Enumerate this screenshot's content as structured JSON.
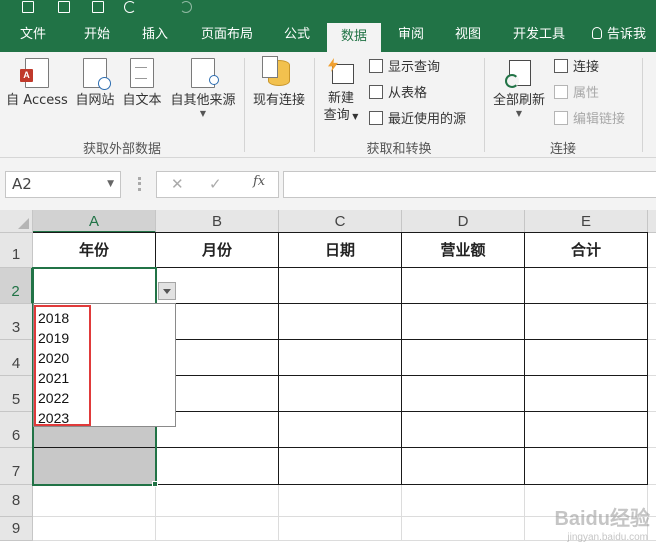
{
  "ribbon": {
    "tabs": [
      {
        "label": "文件"
      },
      {
        "label": "开始"
      },
      {
        "label": "插入"
      },
      {
        "label": "页面布局"
      },
      {
        "label": "公式"
      },
      {
        "label": "数据"
      },
      {
        "label": "审阅"
      },
      {
        "label": "视图"
      },
      {
        "label": "开发工具"
      },
      {
        "label": "告诉我"
      }
    ],
    "active_tab": "数据",
    "groups": {
      "external": {
        "label": "获取外部数据",
        "from_access": "自 Access",
        "from_web": "自网站",
        "from_text": "自文本",
        "from_other": "自其他来源",
        "existing_conn": "现有连接"
      },
      "transform": {
        "label": "获取和转换",
        "new_query_1": "新建",
        "new_query_2": "查询",
        "show_queries": "显示查询",
        "from_table": "从表格",
        "recent_sources": "最近使用的源"
      },
      "connections": {
        "label": "连接",
        "refresh_all": "全部刷新",
        "connections": "连接",
        "properties": "属性",
        "edit_links": "编辑链接"
      }
    }
  },
  "formula_bar": {
    "name_box": "A2",
    "formula": ""
  },
  "sheet": {
    "columns": [
      "A",
      "B",
      "C",
      "D",
      "E"
    ],
    "rows": [
      "1",
      "2",
      "3",
      "4",
      "5",
      "6",
      "7",
      "8",
      "9"
    ],
    "headers": [
      "年份",
      "月份",
      "日期",
      "营业额",
      "合计"
    ],
    "selected_column": "A"
  },
  "dropdown": {
    "options": [
      "2018",
      "2019",
      "2020",
      "2021",
      "2022",
      "2023"
    ]
  },
  "watermark": {
    "main": "Baidu经验",
    "sub": "jingyan.baidu.com"
  },
  "colors": {
    "excel_green": "#217346",
    "highlight_red": "#e03a3a",
    "range_gray": "#c8c8c8"
  }
}
